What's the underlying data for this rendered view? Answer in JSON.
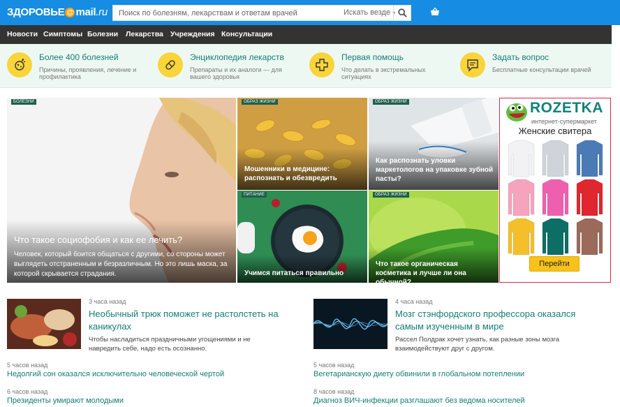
{
  "header": {
    "logo_main": "ЗДОРОВЬЕ",
    "logo_at": "@",
    "logo_brand": "mail",
    "logo_ru": ".ru",
    "search_placeholder": "Поиск по болезням, лекарствам и ответам врачей",
    "search_scope": "Искать везде",
    "search_scope_arrow": "▾",
    "basket_icon": "basket-icon",
    "search_icon": "search-icon"
  },
  "nav": {
    "items": [
      "Новости",
      "Симптомы",
      "Болезни",
      "Лекарства",
      "Учреждения",
      "Консультации"
    ]
  },
  "promos": [
    {
      "title": "Более 400 болезней",
      "desc": "Причины, проявления, лечение и профилактика",
      "icon": "germ-icon"
    },
    {
      "title": "Энциклопедия лекарств",
      "desc": "Препараты и их аналоги — для вашего здоровья",
      "icon": "pill-icon"
    },
    {
      "title": "Первая помощь",
      "desc": "Что делать в экстремальных ситуациях",
      "icon": "first-aid-cross-icon"
    },
    {
      "title": "Задать вопрос",
      "desc": "Бесплатные консультации врачей",
      "icon": "question-chat-icon"
    }
  ],
  "hero": {
    "tag": "БОЛЕЗНИ",
    "title": "Что такое социофобия и как ее лечить?",
    "text": "Человек, который боится общаться с другими, со стороны может выглядеть отстраненным и безразличным. Но это лишь маска, за которой скрывается страдания."
  },
  "tiles": [
    {
      "tag": "ОБРАЗ ЖИЗНИ",
      "title": "Мошенники в медицине: распознать и обезвредить"
    },
    {
      "tag": "ОБРАЗ ЖИЗНИ",
      "title": "Как распознать уловки маркетологов на упаковке зубной пасты?"
    },
    {
      "tag": "ПИТАНИЕ",
      "title": "Учимся питаться правильно"
    },
    {
      "tag": "ОБРАЗ ЖИЗНИ",
      "title": "Что такое органическая косметика и лучше ли она обычной?"
    }
  ],
  "ad": {
    "brand": "ROZETKA",
    "subtitle": "интернет-супермаркет",
    "headline": "Женские свитера",
    "button": "Перейти",
    "sweater_colors": [
      "#f2f2f4",
      "#cfd3da",
      "#4a7bb5",
      "#f6a3bd",
      "#ef5fb0",
      "#e0262f",
      "#f3c02b",
      "#0d6e66",
      "#9b6a5a"
    ]
  },
  "news": [
    {
      "time": "3 часа назад",
      "title": "Необычный трюк поможет не растолстеть на каникулах",
      "desc": "Чтобы насладиться праздничными угощениями и не навредить себе, надо есть осознанно."
    },
    {
      "time": "4 часа назад",
      "title": "Мозг стэнфордского профессора оказался самым изученным в мире",
      "desc": "Рассел Полдрак хочет узнать, как разные зоны мозга взаимодействуют друг с другом."
    },
    {
      "time": "5 часов назад",
      "title": "Недолгий сон оказался исключительно человеческой чертой"
    },
    {
      "time": "5 часов назад",
      "title": "Вегетарианскую диету обвинили в глобальном потеплении"
    },
    {
      "time": "6 часов назад",
      "title": "Президенты умирают молодыми"
    },
    {
      "time": "8 часов назад",
      "title": "Диагноз ВИЧ-инфекции разглашают без ведома носителей"
    }
  ]
}
